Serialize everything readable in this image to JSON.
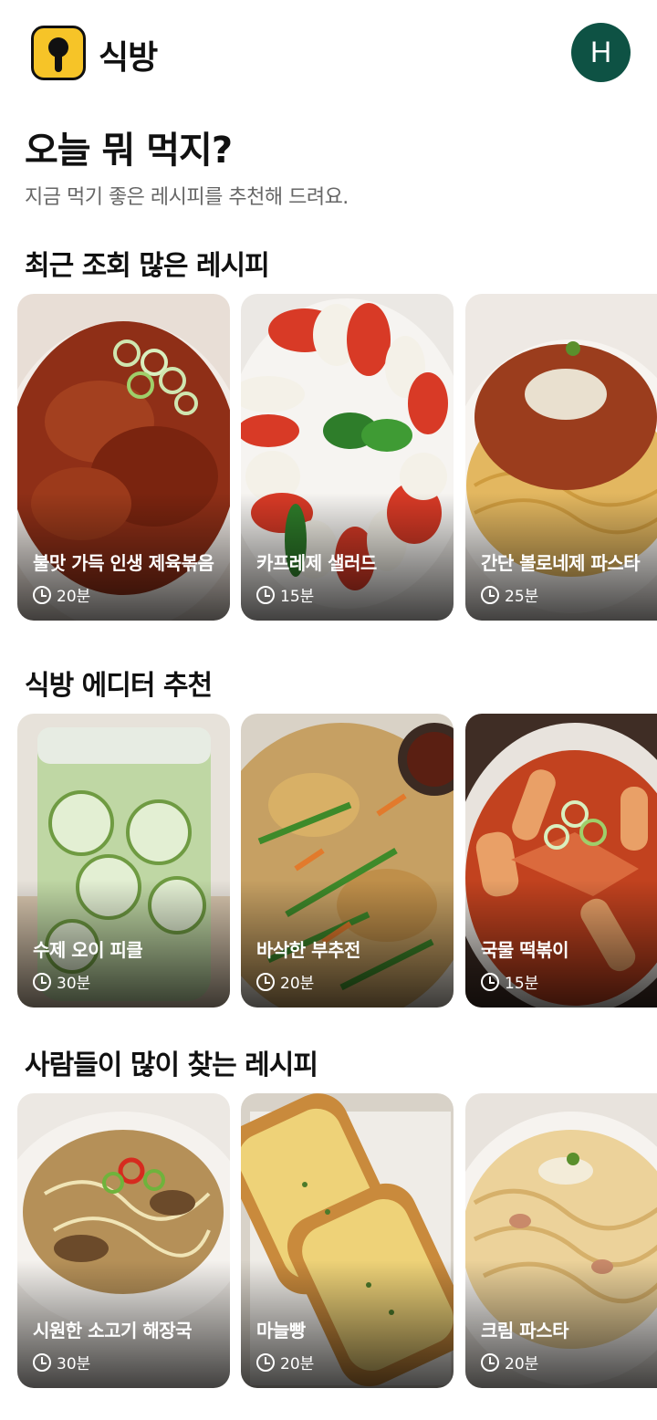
{
  "app": {
    "name": "식방",
    "avatar_initial": "H",
    "brand_color": "#f6c428",
    "avatar_color": "#0e5244"
  },
  "hero": {
    "title": "오늘 뭐 먹지?",
    "subtitle": "지금 먹기 좋은 레시피를 추천해 드려요."
  },
  "sections": [
    {
      "title": "최근 조회 많은 레시피",
      "cards": [
        {
          "title": "불맛 가득 인생 제육볶음",
          "time": "20분"
        },
        {
          "title": "카프레제 샐러드",
          "time": "15분"
        },
        {
          "title": "간단 볼로네제 파스타",
          "time": "25분"
        }
      ]
    },
    {
      "title": "식방 에디터 추천",
      "cards": [
        {
          "title": "수제 오이 피클",
          "time": "30분"
        },
        {
          "title": "바삭한 부추전",
          "time": "20분"
        },
        {
          "title": "국물 떡볶이",
          "time": "15분"
        }
      ]
    },
    {
      "title": "사람들이 많이 찾는 레시피",
      "cards": [
        {
          "title": "시원한 소고기 해장국",
          "time": "30분"
        },
        {
          "title": "마늘빵",
          "time": "20분"
        },
        {
          "title": "크림 파스타",
          "time": "20분"
        }
      ]
    }
  ]
}
